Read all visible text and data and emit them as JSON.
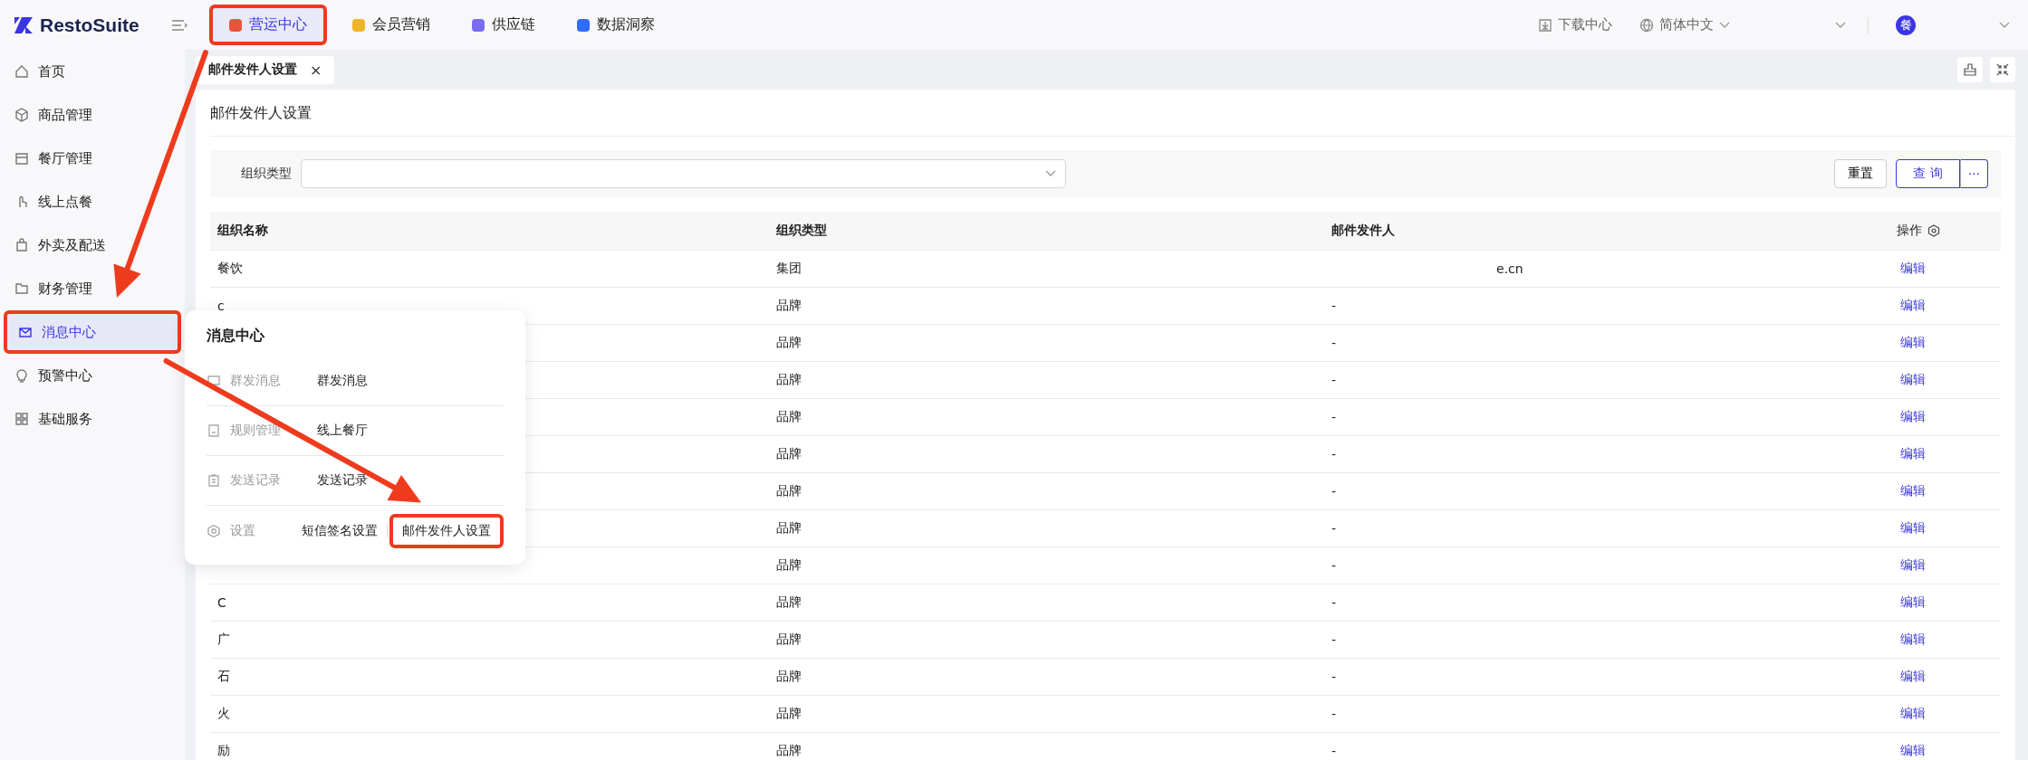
{
  "brand": {
    "name": "RestoSuite"
  },
  "top_nav": [
    {
      "label": "营运中心",
      "selected": true,
      "annotated": true,
      "color": "#e8553a"
    },
    {
      "label": "会员营销",
      "selected": false,
      "annotated": false,
      "color": "#f0b429"
    },
    {
      "label": "供应链",
      "selected": false,
      "annotated": false,
      "color": "#7a6cf0"
    },
    {
      "label": "数据洞察",
      "selected": false,
      "annotated": false,
      "color": "#2f6bff"
    }
  ],
  "header_right": {
    "download": "下载中心",
    "language": "简体中文",
    "avatar": "餐"
  },
  "sidebar": {
    "items": [
      {
        "label": "首页",
        "selected": false,
        "annotated": false
      },
      {
        "label": "商品管理",
        "selected": false,
        "annotated": false
      },
      {
        "label": "餐厅管理",
        "selected": false,
        "annotated": false
      },
      {
        "label": "线上点餐",
        "selected": false,
        "annotated": false
      },
      {
        "label": "外卖及配送",
        "selected": false,
        "annotated": false
      },
      {
        "label": "财务管理",
        "selected": false,
        "annotated": false
      },
      {
        "label": "消息中心",
        "selected": true,
        "annotated": true
      },
      {
        "label": "预警中心",
        "selected": false,
        "annotated": false
      },
      {
        "label": "基础服务",
        "selected": false,
        "annotated": false
      }
    ]
  },
  "flyout": {
    "title": "消息中心",
    "groups": [
      {
        "label": "群发消息",
        "links": [
          {
            "label": "群发消息",
            "annotated": false
          }
        ]
      },
      {
        "label": "规则管理",
        "links": [
          {
            "label": "线上餐厅",
            "annotated": false
          }
        ]
      },
      {
        "label": "发送记录",
        "links": [
          {
            "label": "发送记录",
            "annotated": false
          }
        ]
      },
      {
        "label": "设置",
        "links": [
          {
            "label": "短信签名设置",
            "annotated": false
          },
          {
            "label": "邮件发件人设置",
            "annotated": true
          }
        ]
      }
    ]
  },
  "page_tabs": [
    {
      "label": "邮件发件人设置",
      "selected": true,
      "close": "×"
    }
  ],
  "page": {
    "title": "邮件发件人设置"
  },
  "filter": {
    "label": "组织类型",
    "reset": "重置",
    "query": "查 询",
    "more": "···"
  },
  "table": {
    "columns": [
      "组织名称",
      "组织类型",
      "邮件发件人",
      "操作"
    ],
    "rows": [
      {
        "name": "餐饮",
        "type": "集团",
        "sender": "e.cn",
        "action": "编辑"
      },
      {
        "name": "c",
        "type": "品牌",
        "sender": "-",
        "action": "编辑"
      },
      {
        "type": "品牌",
        "sender": "-",
        "action": "编辑"
      },
      {
        "type": "品牌",
        "sender": "-",
        "action": "编辑"
      },
      {
        "type": "品牌",
        "sender": "-",
        "action": "编辑"
      },
      {
        "type": "品牌",
        "sender": "-",
        "action": "编辑"
      },
      {
        "type": "品牌",
        "sender": "-",
        "action": "编辑"
      },
      {
        "type": "品牌",
        "sender": "-",
        "action": "编辑"
      },
      {
        "type": "品牌",
        "sender": "-",
        "action": "编辑"
      },
      {
        "name": "C",
        "type": "品牌",
        "sender": "-",
        "action": "编辑"
      },
      {
        "name": "广",
        "type": "品牌",
        "sender": "-",
        "action": "编辑"
      },
      {
        "name": "石",
        "type": "品牌",
        "sender": "-",
        "action": "编辑"
      },
      {
        "name": "火",
        "type": "品牌",
        "sender": "-",
        "action": "编辑"
      },
      {
        "name": "励",
        "type": "品牌",
        "sender": "-",
        "action": "编辑"
      }
    ]
  }
}
